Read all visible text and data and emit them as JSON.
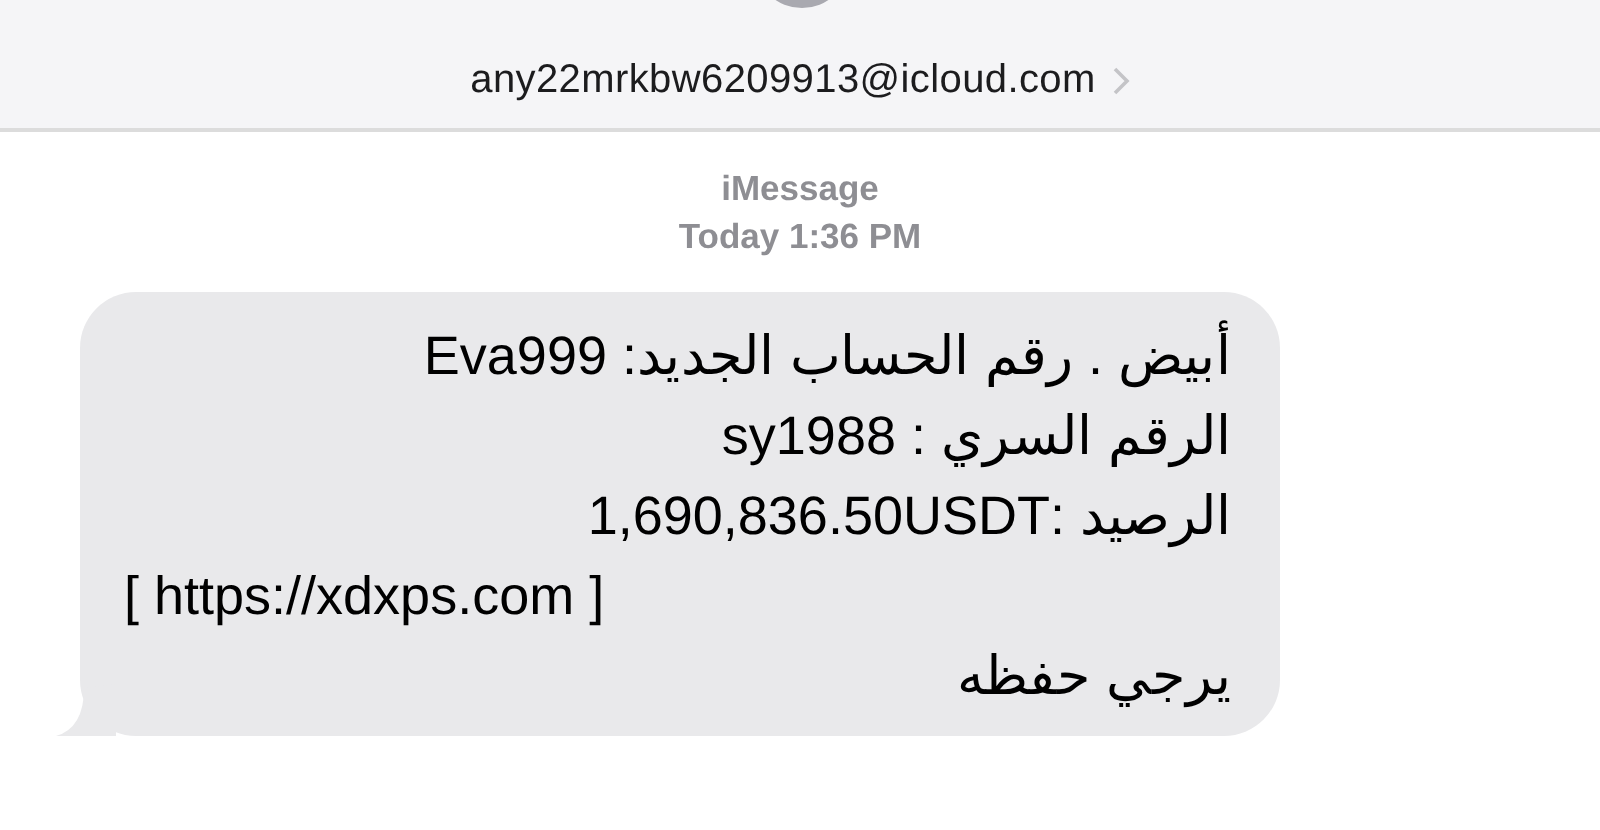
{
  "header": {
    "contact": "any22mrkbw6209913@icloud.com"
  },
  "thread": {
    "service": "iMessage",
    "timestamp": "Today 1:36 PM"
  },
  "message": {
    "lines": [
      {
        "text": "أبيض . رقم الحساب الجديد: Eva999",
        "kind": "text"
      },
      {
        "text": "الرقم السري : sy1988",
        "kind": "text"
      },
      {
        "text": "الرصيد :1,690,836.50USDT",
        "kind": "text"
      },
      {
        "text": "[ https://xdxps.com ]",
        "kind": "link"
      },
      {
        "text": "يرجي  حفظه",
        "kind": "text"
      }
    ]
  }
}
